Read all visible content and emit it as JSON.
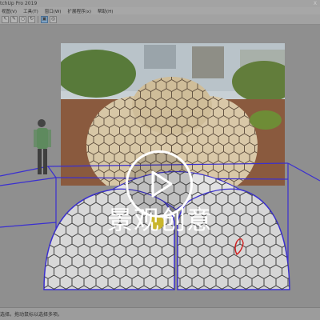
{
  "window": {
    "title": "tchUp Pro 2019",
    "title_right": "X"
  },
  "menubar": {
    "items": [
      "视图(V)",
      "工具(T)",
      "窗口(W)",
      "扩展程序(x)",
      "帮助(H)"
    ]
  },
  "toolbar": {
    "buttons": [
      {
        "icon": "arrow-icon",
        "glyph": "↖"
      },
      {
        "icon": "pencil-icon",
        "glyph": "✎"
      },
      {
        "icon": "circle-icon",
        "glyph": "○"
      },
      {
        "icon": "rotate-icon",
        "glyph": "↻"
      },
      {
        "icon": "select-icon",
        "glyph": "▣",
        "active": true
      },
      {
        "icon": "orbit-icon",
        "glyph": "◎"
      }
    ]
  },
  "statusbar": {
    "text": "选择。拖动鼠标以选择多项。"
  },
  "overlay": {
    "caption": "景观创意",
    "play_icon": "play-icon"
  },
  "colors": {
    "background": "#8f8f8f",
    "axis_blue": "#3a2fd0",
    "hex_stroke": "#3f3f3f",
    "dome_fill": "#dcdcdc",
    "photo_sky": "#c7d0d6",
    "photo_ground": "#8b5a3c"
  }
}
